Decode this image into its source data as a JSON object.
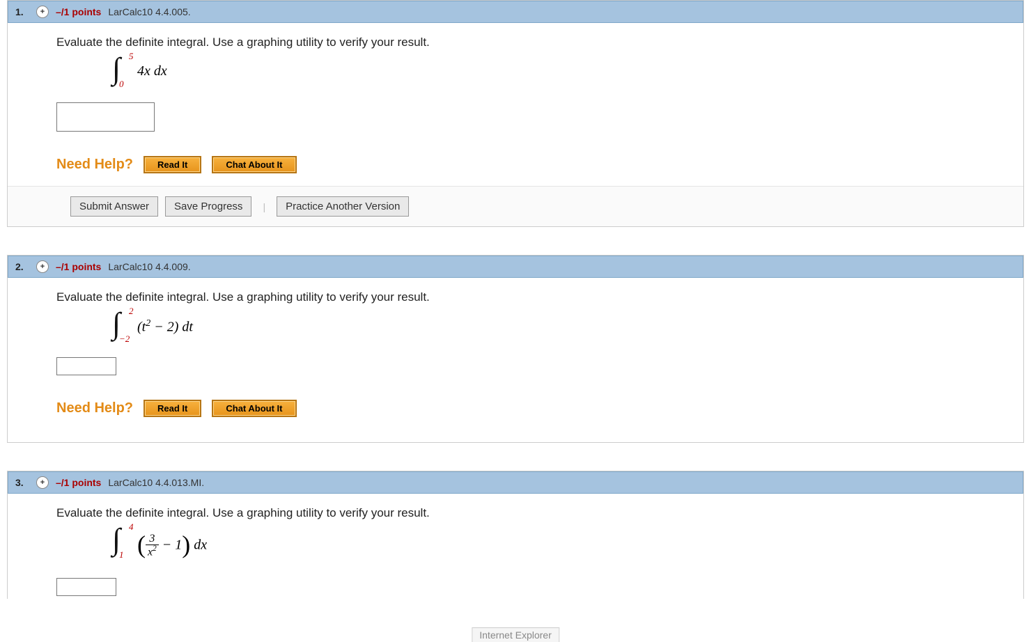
{
  "questions": [
    {
      "number": "1.",
      "points": "–/1 points",
      "source": "LarCalc10 4.4.005.",
      "prompt": "Evaluate the definite integral. Use a graphing utility to verify your result.",
      "integral": {
        "upper": "5",
        "lower": "0",
        "integrand_html": "4<i>x</i> <i>dx</i>"
      },
      "answer_size": "large",
      "help": {
        "label": "Need Help?",
        "read": "Read It",
        "chat": "Chat About It"
      },
      "actions": {
        "submit": "Submit Answer",
        "save": "Save Progress",
        "practice": "Practice Another Version"
      }
    },
    {
      "number": "2.",
      "points": "–/1 points",
      "source": "LarCalc10 4.4.009.",
      "prompt": "Evaluate the definite integral. Use a graphing utility to verify your result.",
      "integral": {
        "upper": "2",
        "lower": "−2",
        "integrand_html": "(<i>t</i><sup>2</sup> − 2) <i>dt</i>"
      },
      "answer_size": "small",
      "help": {
        "label": "Need Help?",
        "read": "Read It",
        "chat": "Chat About It"
      }
    },
    {
      "number": "3.",
      "points": "–/1 points",
      "source": "LarCalc10 4.4.013.MI.",
      "prompt": "Evaluate the definite integral. Use a graphing utility to verify your result.",
      "integral": {
        "upper": "4",
        "lower": "1",
        "integrand_html": "<span class=\"big-paren\">(</span><span class=\"frac\"><span class=\"num\">3</span><span class=\"den\"><i>x</i><sup>2</sup></span></span> − 1<span class=\"big-paren\">)</span> <i>dx</i>"
      },
      "answer_size": "small"
    }
  ],
  "status_bar": "Internet Explorer"
}
